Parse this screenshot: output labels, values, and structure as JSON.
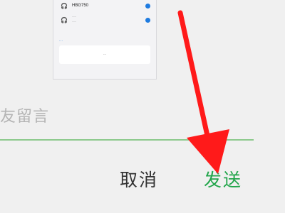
{
  "dialog": {
    "message_placeholder": "友留言",
    "cancel_label": "取消",
    "send_label": "发送",
    "send_color": "#21a54a",
    "underline_color": "#8cc98c"
  },
  "preview": {
    "row1_text": "HBG750",
    "row2_text": "···",
    "row2_sub": "···",
    "section_label": "···",
    "card_text": "···"
  },
  "annotation": {
    "arrow_color": "#ff1a1a",
    "arrow_target": "send-button"
  }
}
